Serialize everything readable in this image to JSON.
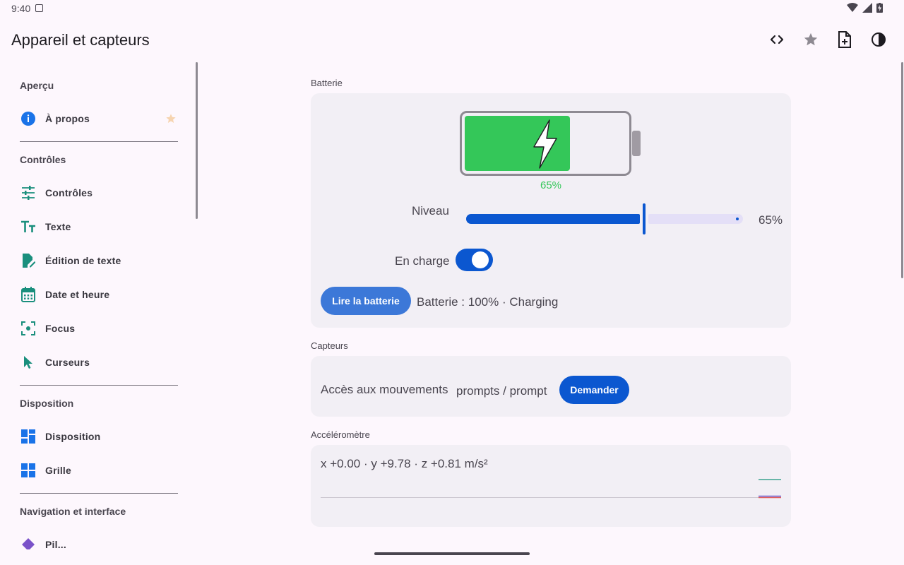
{
  "status_bar": {
    "time": "9:40"
  },
  "app_bar": {
    "title": "Appareil et capteurs",
    "actions": [
      "code-icon",
      "star-icon",
      "add-document-icon",
      "contrast-icon"
    ]
  },
  "sidebar": {
    "sections": [
      {
        "header": "Aperçu",
        "items": [
          {
            "label": "À propos",
            "icon": "info-icon",
            "favorite": true
          }
        ]
      },
      {
        "header": "Contrôles",
        "items": [
          {
            "label": "Contrôles",
            "icon": "tune-icon"
          },
          {
            "label": "Texte",
            "icon": "text-format-icon"
          },
          {
            "label": "Édition de texte",
            "icon": "edit-document-icon"
          },
          {
            "label": "Date et heure",
            "icon": "calendar-icon"
          },
          {
            "label": "Focus",
            "icon": "focus-icon"
          },
          {
            "label": "Curseurs",
            "icon": "cursor-icon"
          }
        ]
      },
      {
        "header": "Disposition",
        "items": [
          {
            "label": "Disposition",
            "icon": "dashboard-icon"
          },
          {
            "label": "Grille",
            "icon": "grid-icon"
          }
        ]
      },
      {
        "header": "Navigation et interface",
        "items": [
          {
            "label": "Pil...",
            "icon": "diamond-icon"
          }
        ]
      }
    ]
  },
  "battery": {
    "section_label": "Batterie",
    "level_display": "65%",
    "level_label": "Niveau",
    "level_value": "65%",
    "level_fraction": 0.65,
    "charging_label": "En charge",
    "charging": true,
    "read_button": "Lire la batterie",
    "status": "Batterie : 100% · Charging"
  },
  "sensors": {
    "section_label": "Capteurs",
    "motion_label": "Accès aux mouvements",
    "motion_status": "prompts / prompt",
    "request_button": "Demander"
  },
  "accelerometer": {
    "section_label": "Accéléromètre",
    "reading": "x +0.00 · y +9.78 · z +0.81 m/s²"
  },
  "colors": {
    "primary": "#0b57d0",
    "battery_green": "#34c759",
    "button_blue": "#3c78d8",
    "nav_icon_teal": "#1a8f7d",
    "nav_icon_blue": "#1a73e8"
  }
}
